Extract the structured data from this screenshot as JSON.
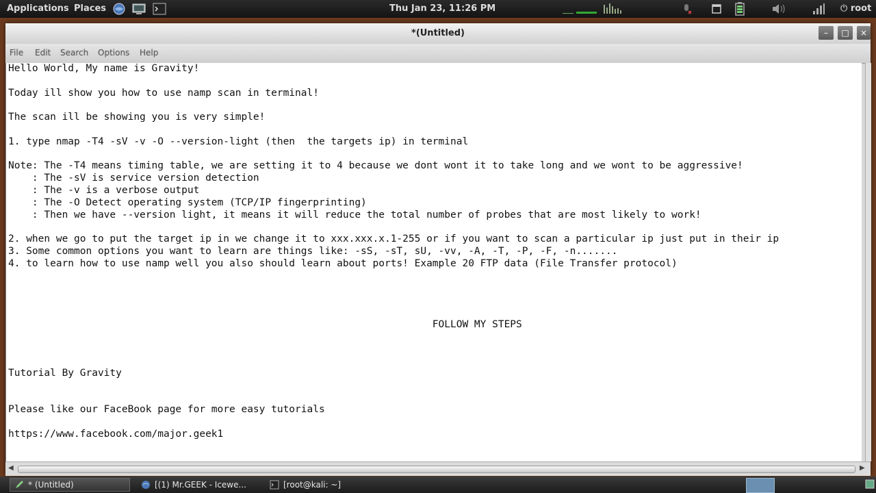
{
  "top_panel": {
    "applications": "Applications",
    "places": "Places",
    "launchers": [
      "browser-icon",
      "file-manager-icon",
      "terminal-icon"
    ],
    "clock": "Thu Jan 23, 11:26 PM",
    "tray_icons": [
      "network-graph-icon",
      "microphone-muted-icon",
      "window-list-icon",
      "battery-icon",
      "volume-icon",
      "network-signal-icon"
    ],
    "user": "root"
  },
  "window": {
    "title": "*(Untitled)",
    "controls": {
      "minimize": "–",
      "maximize": "□",
      "close": "×"
    },
    "menu": [
      "File",
      "Edit",
      "Search",
      "Options",
      "Help"
    ]
  },
  "editor": {
    "lines": [
      "Hello World, My name is Gravity!",
      "",
      "Today ill show you how to use namp scan in terminal!",
      "",
      "The scan ill be showing you is very simple!",
      "",
      "1. type nmap -T4 -sV -v -O --version-light (then  the targets ip) in terminal",
      "",
      "Note: The -T4 means timing table, we are setting it to 4 because we dont wont it to take long and we wont to be aggressive!",
      "    : The -sV is service version detection",
      "    : The -v is a verbose output",
      "    : The -O Detect operating system (TCP/IP fingerprinting)",
      "    : Then we have --version light, it means it will reduce the total number of probes that are most likely to work!",
      "",
      "2. when we go to put the target ip in we change it to xxx.xxx.x.1-255 or if you want to scan a particular ip just put in their ip",
      "3. Some common options you want to learn are things like: -sS, -sT, sU, -vv, -A, -T, -P, -F, -n.......",
      "4. to learn how to use namp well you also should learn about ports! Example 20 FTP data (File Transfer protocol)",
      "",
      "",
      "",
      "",
      "                                                                       FOLLOW MY STEPS",
      "",
      "",
      "",
      "Tutorial By Gravity",
      "",
      "",
      "Please like our FaceBook page for more easy tutorials",
      "",
      "https://www.facebook.com/major.geek1"
    ]
  },
  "taskbar": {
    "tasks": [
      {
        "label": "* (Untitled)",
        "icon": "text-editor-icon"
      },
      {
        "label": "[(1) Mr.GEEK - Icewe...",
        "icon": "iceweasel-icon"
      },
      {
        "label": "[root@kali: ~]",
        "icon": "terminal-icon"
      }
    ]
  },
  "colors": {
    "panel_bg": "#1c1c1c",
    "editor_bg": "#ffffff",
    "text": "#111111",
    "desktop": "#6b3a1e"
  }
}
